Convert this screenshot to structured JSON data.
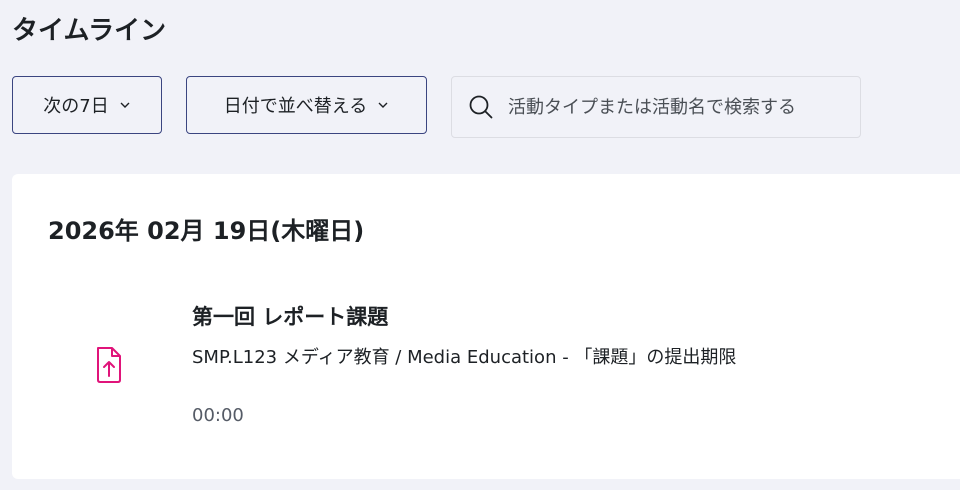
{
  "page": {
    "title": "タイムライン"
  },
  "filters": {
    "days_label": "次の7日",
    "sort_label": "日付で並べ替える"
  },
  "search": {
    "placeholder": "活動タイプまたは活動名で検索する",
    "value": ""
  },
  "timeline": {
    "date_heading": "2026年 02月 19日(木曜日)",
    "events": [
      {
        "icon": "assignment-upload-icon",
        "title": "第一回 レポート課題",
        "description": "SMP.L123 メディア教育 / Media Education - 「課題」の提出期限",
        "time": "00:00"
      }
    ]
  },
  "colors": {
    "background": "#f1f2f8",
    "card": "#ffffff",
    "dropdown_border": "#3b4580",
    "assignment_icon": "#e0147a"
  }
}
